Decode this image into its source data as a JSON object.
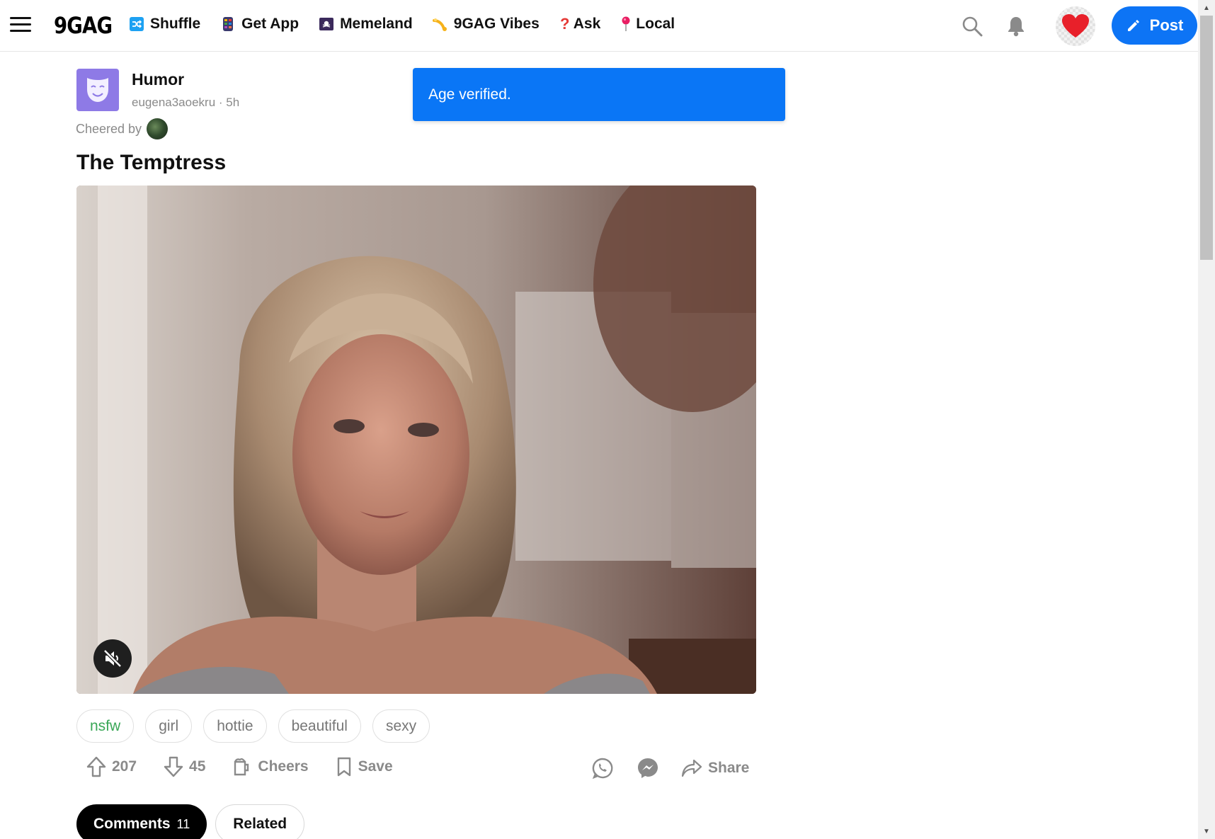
{
  "header": {
    "logo": "9GAG",
    "nav": [
      {
        "label": "Shuffle",
        "icon": "shuffle-icon"
      },
      {
        "label": "Get App",
        "icon": "phone-icon"
      },
      {
        "label": "Memeland",
        "icon": "pirate-flag-icon"
      },
      {
        "label": "9GAG Vibes",
        "icon": "vibes-icon"
      },
      {
        "label": "Ask",
        "icon": "question-mark-icon"
      },
      {
        "label": "Local",
        "icon": "pin-icon"
      }
    ],
    "post_label": "Post"
  },
  "toast": {
    "message": "Age verified."
  },
  "post": {
    "section": "Humor",
    "author": "eugena3aoekru",
    "separator": " · ",
    "age": "5h",
    "cheered_by_label": "Cheered by",
    "title": "The Temptress",
    "tags": [
      "nsfw",
      "girl",
      "hottie",
      "beautiful",
      "sexy"
    ],
    "upvotes": "207",
    "downvotes": "45",
    "cheers_label": "Cheers",
    "save_label": "Save",
    "share_label": "Share"
  },
  "tabs": {
    "comments_label": "Comments",
    "comments_count": "11",
    "related_label": "Related"
  },
  "colors": {
    "accent": "#0d74f5",
    "toast": "#0a76f6",
    "nsfw_tag": "#3aa757",
    "section_avatar": "#8e7ae6",
    "heart": "#e8202a"
  }
}
